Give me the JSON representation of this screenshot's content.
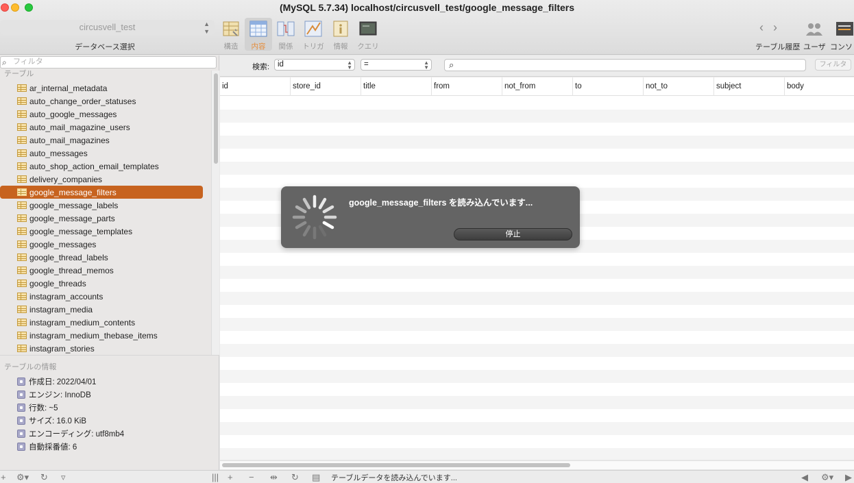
{
  "window": {
    "title": "(MySQL 5.7.34) localhost/circusvell_test/google_message_filters"
  },
  "toolbar": {
    "database": "circusvell_test",
    "database_label": "データベース選択",
    "buttons": [
      {
        "label": "構造",
        "icon": "structure-icon"
      },
      {
        "label": "内容",
        "icon": "content-icon",
        "active": true
      },
      {
        "label": "関係",
        "icon": "relations-icon"
      },
      {
        "label": "トリガ",
        "icon": "triggers-icon"
      },
      {
        "label": "情報",
        "icon": "info-icon"
      },
      {
        "label": "クエリ",
        "icon": "query-icon"
      }
    ],
    "right": {
      "history_label": "テーブル履歴",
      "users_label": "ユーザ",
      "console_label": "コンソー"
    }
  },
  "sidebar": {
    "filter_placeholder": "フィルタ",
    "tables_heading": "テーブル",
    "tables": [
      "ar_internal_metadata",
      "auto_change_order_statuses",
      "auto_google_messages",
      "auto_mail_magazine_users",
      "auto_mail_magazines",
      "auto_messages",
      "auto_shop_action_email_templates",
      "delivery_companies",
      "google_message_filters",
      "google_message_labels",
      "google_message_parts",
      "google_message_templates",
      "google_messages",
      "google_thread_labels",
      "google_thread_memos",
      "google_threads",
      "instagram_accounts",
      "instagram_media",
      "instagram_medium_contents",
      "instagram_medium_thebase_items",
      "instagram_stories"
    ],
    "selected_table": "google_message_filters",
    "info_heading": "テーブルの情報",
    "info": [
      "作成日: 2022/04/01",
      "エンジン: InnoDB",
      "行数: ~5",
      "サイズ: 16.0 KiB",
      "エンコーディング: utf8mb4",
      "自動採番値: 6"
    ]
  },
  "search": {
    "label": "検索:",
    "field": "id",
    "operator": "=",
    "value": "",
    "filter_button": "フィルタ"
  },
  "grid": {
    "columns": [
      "id",
      "store_id",
      "title",
      "from",
      "not_from",
      "to",
      "not_to",
      "subject",
      "body"
    ]
  },
  "loading": {
    "message": "google_message_filters を読み込んでいます...",
    "stop_label": "停止"
  },
  "status": {
    "text": "テーブルデータを読み込んでいます..."
  }
}
